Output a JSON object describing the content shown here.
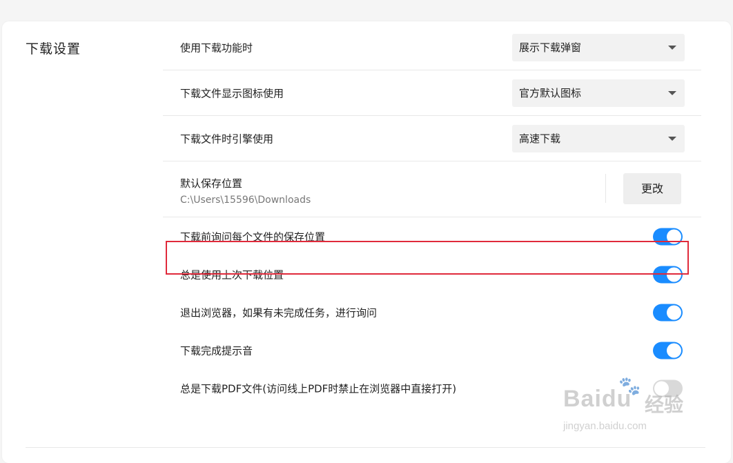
{
  "section": {
    "title": "下载设置"
  },
  "settings": {
    "download_behavior": {
      "label": "使用下载功能时",
      "value": "展示下载弹窗"
    },
    "file_icon": {
      "label": "下载文件显示图标使用",
      "value": "官方默认图标"
    },
    "engine": {
      "label": "下载文件时引擎使用",
      "value": "高速下载"
    },
    "save_location": {
      "label": "默认保存位置",
      "path": "C:\\Users\\15596\\Downloads",
      "button_label": "更改"
    },
    "toggles": [
      {
        "label": "下载前询问每个文件的保存位置",
        "on": true
      },
      {
        "label": "总是使用上次下载位置",
        "on": true
      },
      {
        "label": "退出浏览器，如果有未完成任务，进行询问",
        "on": true
      },
      {
        "label": "下载完成提示音",
        "on": true
      },
      {
        "label": "总是下载PDF文件(访问线上PDF时禁止在浏览器中直接打开)",
        "on": false
      }
    ]
  },
  "colors": {
    "accent": "#1a8cff",
    "highlight": "#e0293a"
  },
  "watermark": {
    "brand": "Baidu",
    "brand_cn": "经验",
    "url": "jingyan.baidu.com"
  }
}
